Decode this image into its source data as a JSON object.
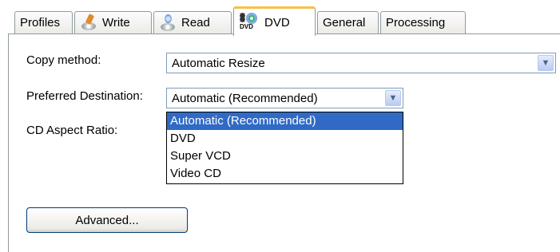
{
  "tabs": [
    {
      "label": "Profiles",
      "icon": null,
      "active": false
    },
    {
      "label": "Write",
      "icon": "write-disc-icon",
      "active": false
    },
    {
      "label": "Read",
      "icon": "read-disc-icon",
      "active": false
    },
    {
      "label": "DVD",
      "icon": "dvd-icon",
      "active": true
    },
    {
      "label": "General",
      "icon": null,
      "active": false
    },
    {
      "label": "Processing",
      "icon": null,
      "active": false
    }
  ],
  "dvd_icon_text": "DVD",
  "copy_method": {
    "label": "Copy method:",
    "value": "Automatic Resize"
  },
  "preferred_destination": {
    "label": "Preferred Destination:",
    "value": "Automatic (Recommended)",
    "options": [
      "Automatic (Recommended)",
      "DVD",
      "Super VCD",
      "Video CD"
    ],
    "highlighted": "Automatic (Recommended)"
  },
  "cd_aspect_ratio": {
    "label": "CD Aspect Ratio:"
  },
  "advanced_button": {
    "label": "Advanced..."
  },
  "colors": {
    "accent_tab": "#f7c04a",
    "selection": "#316ac5",
    "combo_border": "#7f9db9"
  }
}
